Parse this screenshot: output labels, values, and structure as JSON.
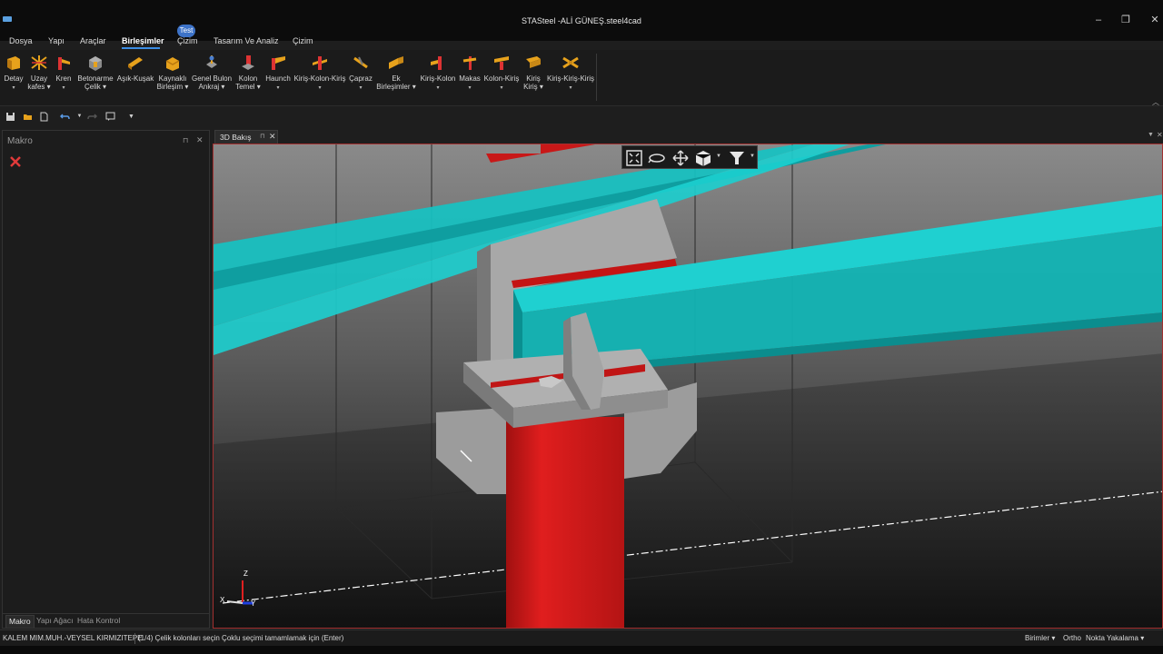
{
  "window": {
    "title": "STASteel -ALİ GÜNEŞ.steel4cad",
    "controls": [
      "–",
      "❐",
      "✕"
    ]
  },
  "menu": {
    "items": [
      "Dosya",
      "Yapı",
      "Araçlar",
      "Birleşimler",
      "Çizim",
      "Tasarım Ve Analiz",
      "Çizim"
    ],
    "active": "Birleşimler",
    "badge": "Test"
  },
  "ribbon": {
    "buttons": [
      {
        "l1": "Detay",
        "l2": "▾",
        "icon": "detail-icon"
      },
      {
        "l1": "Uzay",
        "l2": "kafes ▾",
        "icon": "space-truss-icon"
      },
      {
        "l1": "Kren",
        "l2": "▾",
        "icon": "crane-icon"
      },
      {
        "l1": "Betonarme",
        "l2": "Çelik ▾",
        "icon": "rc-steel-icon"
      },
      {
        "l1": "Aşık-Kuşak",
        "l2": "",
        "icon": "purlin-icon"
      },
      {
        "l1": "Kaynaklı",
        "l2": "Birleşim ▾",
        "icon": "welded-joint-icon"
      },
      {
        "l1": "Genel Bulon",
        "l2": "Ankraj ▾",
        "icon": "anchor-bolt-icon"
      },
      {
        "l1": "Kolon",
        "l2": "Temel ▾",
        "icon": "column-base-icon"
      },
      {
        "l1": "Haunch",
        "l2": "▾",
        "icon": "haunch-icon"
      },
      {
        "l1": "Kiriş-Kolon-Kiriş",
        "l2": "▾",
        "icon": "beam-column-beam-icon"
      },
      {
        "l1": "Çapraz",
        "l2": "▾",
        "icon": "bracing-icon"
      },
      {
        "l1": "Ek",
        "l2": "Birleşimler ▾",
        "icon": "splice-icon"
      },
      {
        "l1": "Kiriş-Kolon",
        "l2": "▾",
        "icon": "beam-column-icon"
      },
      {
        "l1": "Makas",
        "l2": "▾",
        "icon": "truss-icon"
      },
      {
        "l1": "Kolon-Kiriş",
        "l2": "▾",
        "icon": "column-beam-icon"
      },
      {
        "l1": "Kiriş",
        "l2": "Kiriş ▾",
        "icon": "beam-beam-icon"
      },
      {
        "l1": "Kiriş-Kiriş-Kiriş",
        "l2": "▾",
        "icon": "beam-beam-beam-icon"
      }
    ]
  },
  "quick_access": [
    "save-icon",
    "open-icon",
    "new-icon",
    "undo-icon",
    "redo-icon",
    "comment-icon",
    "customize-icon"
  ],
  "left_panel": {
    "title": "Makro",
    "pin": "⊓",
    "close": "✕",
    "tabs": [
      "Makro",
      "Yapı Ağacı",
      "Hata Kontrol"
    ],
    "active_tab": "Makro"
  },
  "viewport": {
    "tab_label": "3D Bakış",
    "tab_pin": "⊓",
    "tab_close": "✕",
    "axes": {
      "z": "Z",
      "x": "X",
      "y": "Y"
    }
  },
  "status": {
    "user": "KALEM MIM.MUH.-VEYSEL KIRMIZITEPE",
    "message": "(1/4) Çelik kolonları seçin Çoklu seçimi tamamlamak için (Enter)",
    "units": "Birimler",
    "ortho": "Ortho",
    "snap": "Nokta Yakalama"
  },
  "colors": {
    "beam": "#1ec8c8",
    "column": "#d81818",
    "plate": "#9a9a9a",
    "accent": "#3c8ee6"
  }
}
